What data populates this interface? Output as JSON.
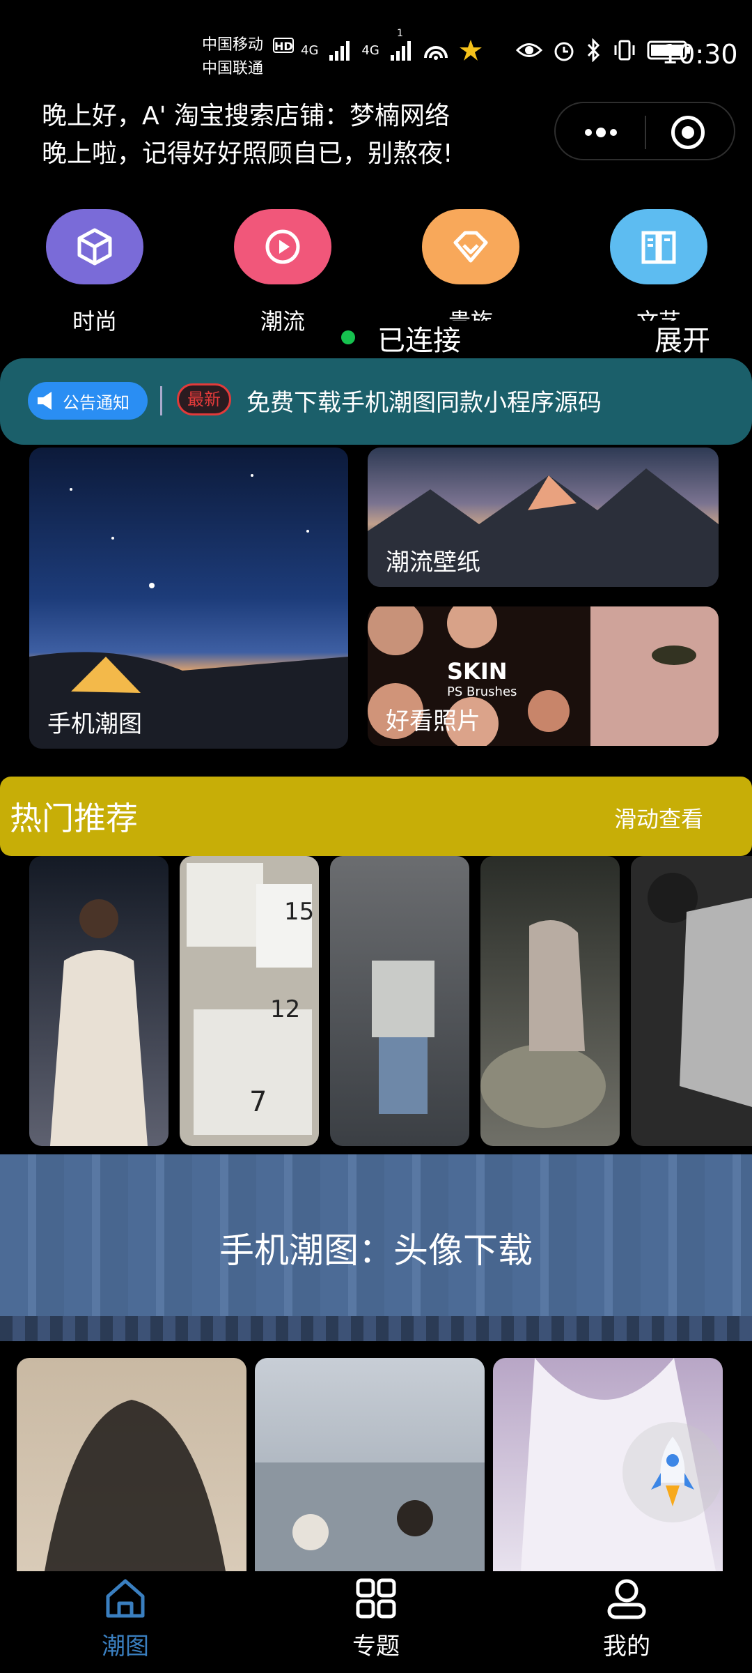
{
  "status_bar": {
    "carrier1": "中国移动",
    "carrier2": "中国联通",
    "hd": "HD",
    "net1": "4G",
    "net2": "4G",
    "hotspot_badge": "1",
    "time": "10:30"
  },
  "greeting": {
    "line1": "晚上好，A' 淘宝搜索店铺：梦楠网络",
    "line2": "晚上啦，记得好好照顾自已，别熬夜!"
  },
  "categories": [
    {
      "label": "时尚",
      "color": "#7a6bd8",
      "icon": "cube-icon"
    },
    {
      "label": "潮流",
      "color": "#f1577a",
      "icon": "play-icon"
    },
    {
      "label": "贵族",
      "color": "#f8a85a",
      "icon": "diamond-icon"
    },
    {
      "label": "文艺",
      "color": "#5dbcf1",
      "icon": "book-icon"
    }
  ],
  "connection": {
    "status": "已连接",
    "expand": "展开"
  },
  "notice": {
    "badge": "公告通知",
    "new": "最新",
    "text": "免费下载手机潮图同款小程序源码"
  },
  "features": {
    "large": "手机潮图",
    "top_right": "潮流壁纸",
    "bottom_right": "好看照片",
    "skin_title": "SKIN",
    "skin_sub": "PS Brushes"
  },
  "hot": {
    "title": "热门推荐",
    "hint": "滑动查看"
  },
  "thumb_texts": {
    "t2_a": "15",
    "t2_b": "12",
    "t2_c": "7"
  },
  "banner": {
    "title": "手机潮图：头像下载"
  },
  "tabs": [
    {
      "label": "潮图",
      "active": true,
      "icon": "home-icon"
    },
    {
      "label": "专题",
      "active": false,
      "icon": "grid-icon"
    },
    {
      "label": "我的",
      "active": false,
      "icon": "user-icon"
    }
  ],
  "colors": {
    "active_tab": "#3a7fc0",
    "hot_bg": "#c7ae07",
    "notice_bg": "#1b5f6a",
    "connected_dot": "#16c24f"
  }
}
